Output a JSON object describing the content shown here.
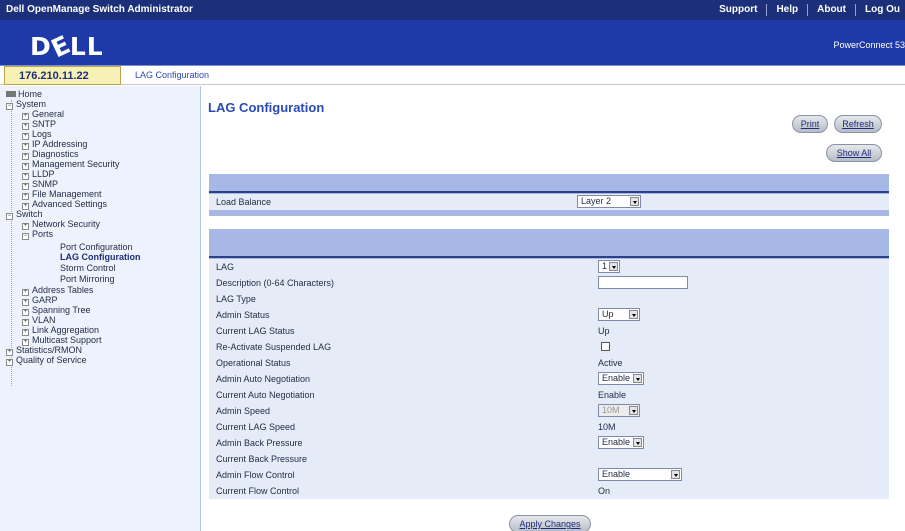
{
  "app": {
    "title": "Dell OpenManage Switch Administrator",
    "logo": "DELL",
    "model": "PowerConnect 53"
  },
  "topnav": [
    "Support",
    "Help",
    "About",
    "Log Ou"
  ],
  "address": {
    "ip": "176.210.11.22",
    "breadcrumb": "LAG Configuration"
  },
  "tree": {
    "home": "Home",
    "system": "System",
    "system_items": [
      "General",
      "SNTP",
      "Logs",
      "IP Addressing",
      "Diagnostics",
      "Management Security",
      "LLDP",
      "SNMP",
      "File Management",
      "Advanced Settings"
    ],
    "switch": "Switch",
    "network_security": "Network Security",
    "ports": "Ports",
    "port_items": [
      "Port Configuration",
      "LAG Configuration",
      "Storm Control",
      "Port Mirroring"
    ],
    "switch_items": [
      "Address Tables",
      "GARP",
      "Spanning Tree",
      "VLAN",
      "Link Aggregation",
      "Multicast Support"
    ],
    "root_items": [
      "Statistics/RMON",
      "Quality of Service"
    ]
  },
  "page": {
    "title": "LAG Configuration",
    "buttons": {
      "print": "Print",
      "refresh": "Refresh",
      "show_all": "Show All",
      "apply": "Apply Changes"
    },
    "load_balance": {
      "label": "Load Balance",
      "value": "Layer 2"
    },
    "fields": {
      "lag": {
        "label": "LAG",
        "value": "1"
      },
      "description": {
        "label": "Description (0-64 Characters)",
        "value": ""
      },
      "lag_type": {
        "label": "LAG Type",
        "value": ""
      },
      "admin_status": {
        "label": "Admin Status",
        "value": "Up"
      },
      "current_lag_status": {
        "label": "Current LAG Status",
        "value": "Up"
      },
      "reactivate": {
        "label": "Re-Activate Suspended LAG"
      },
      "operational_status": {
        "label": "Operational Status",
        "value": "Active"
      },
      "admin_auto_neg": {
        "label": "Admin Auto Negotiation",
        "value": "Enable"
      },
      "current_auto_neg": {
        "label": "Current Auto Negotiation",
        "value": "Enable"
      },
      "admin_speed": {
        "label": "Admin Speed",
        "value": "10M"
      },
      "current_lag_speed": {
        "label": "Current LAG Speed",
        "value": "10M"
      },
      "admin_back_pressure": {
        "label": "Admin Back Pressure",
        "value": "Enable"
      },
      "current_back_pressure": {
        "label": "Current Back Pressure",
        "value": ""
      },
      "admin_flow_control": {
        "label": "Admin Flow Control",
        "value": "Enable"
      },
      "current_flow_control": {
        "label": "Current Flow Control",
        "value": "On"
      }
    }
  }
}
